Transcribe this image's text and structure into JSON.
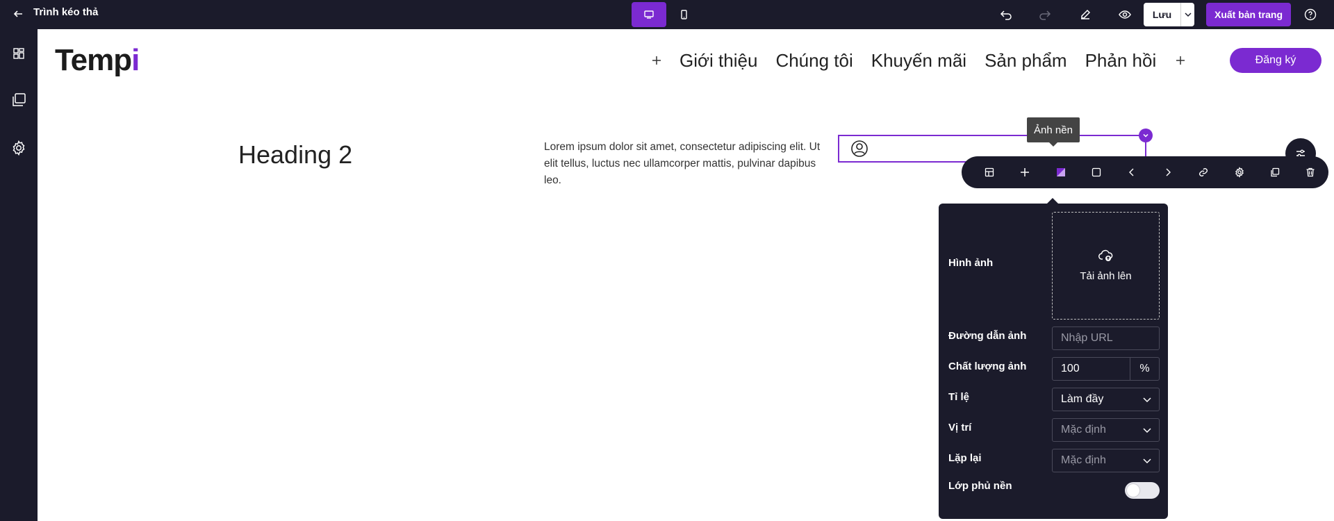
{
  "topbar": {
    "title": "Trình kéo thả",
    "save_label": "Lưu",
    "publish_label": "Xuất bản trang"
  },
  "header": {
    "logo_main": "Temp",
    "logo_accent": "i",
    "nav": [
      "Giới thiệu",
      "Chúng tôi",
      "Khuyến mãi",
      "Sản phẩm",
      "Phản hồi"
    ],
    "register_label": "Đăng ký"
  },
  "content": {
    "heading": "Heading 2",
    "paragraph": "Lorem ipsum dolor sit amet, consectetur adipiscing elit. Ut elit tellus, luctus nec ullamcorper mattis, pulvinar dapibus leo."
  },
  "tooltip": "Ảnh nền",
  "panel": {
    "image_label": "Hình ảnh",
    "upload_text": "Tải ảnh lên",
    "url_label": "Đường dẫn ảnh",
    "url_placeholder": "Nhập URL",
    "quality_label": "Chất lượng ảnh",
    "quality_value": "100",
    "quality_unit": "%",
    "ratio_label": "Tỉ lệ",
    "ratio_value": "Làm đầy",
    "position_label": "Vị trí",
    "position_value": "Mặc định",
    "repeat_label": "Lặp lại",
    "repeat_value": "Mặc định",
    "overlay_label": "Lớp phủ nền",
    "overlay_on": false
  },
  "colors": {
    "brand": "#7b2ad1",
    "dark": "#1b1b2b"
  }
}
